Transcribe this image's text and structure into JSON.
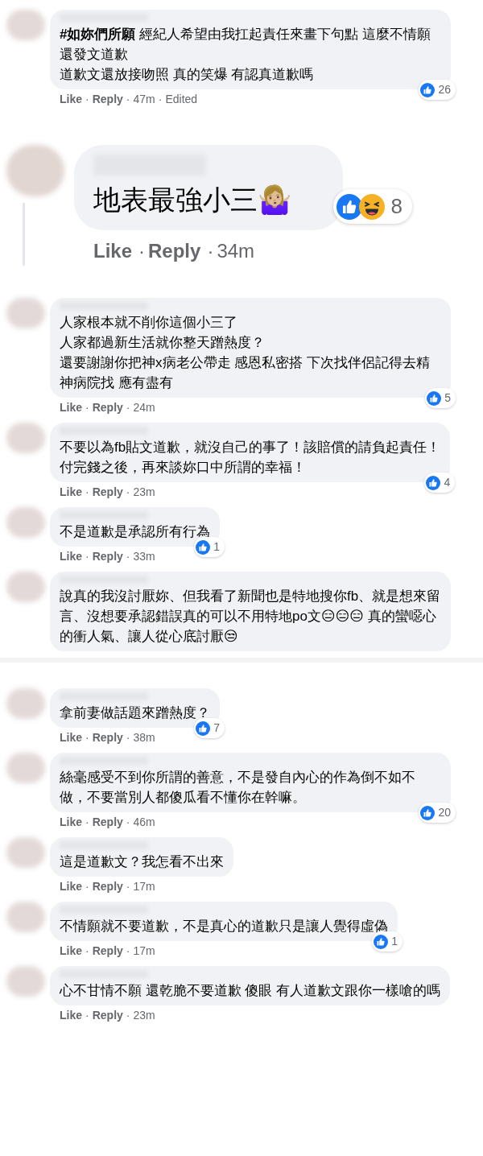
{
  "separator": "·",
  "panels": [
    {
      "comments": [
        {
          "kind": "normal",
          "lines": [
            "**#如妳們所願** 經紀人希望由我扛起責任來畫下句點 這麼不情願還發文道歉",
            "道歉文還放接吻照 真的笑爆 有認真道歉嗎"
          ],
          "meta": [
            "Like",
            "Reply",
            "47m",
            "Edited"
          ],
          "reactions": [
            {
              "kind": "like"
            }
          ],
          "reaction_count": "26"
        }
      ]
    },
    {
      "comments": [
        {
          "kind": "zoomed",
          "lines": [
            "地表最強小三🤷🏼‍♀️"
          ],
          "meta": [
            "Like",
            "Reply",
            "34m"
          ],
          "reactions": [
            {
              "kind": "like"
            },
            {
              "kind": "haha"
            }
          ],
          "reaction_count": "8"
        }
      ]
    },
    {
      "comments": [
        {
          "kind": "normal",
          "lines": [
            "人家根本就不削你這個小三了",
            "人家都過新生活就你整天蹭熱度？",
            "還要謝謝你把神x病老公帶走 感恩私密搭 下次找伴侶記得去精神病院找 應有盡有"
          ],
          "meta": [
            "Like",
            "Reply",
            "24m"
          ],
          "reactions": [
            {
              "kind": "like"
            }
          ],
          "reaction_count": "5"
        },
        {
          "kind": "normal",
          "lines": [
            "不要以為fb貼文道歉，就沒自己的事了！該賠償的請負起責任！",
            "付完錢之後，再來談妳口中所謂的幸福！"
          ],
          "meta": [
            "Like",
            "Reply",
            "23m"
          ],
          "reactions": [
            {
              "kind": "like"
            }
          ],
          "reaction_count": "4"
        },
        {
          "kind": "normal",
          "lines": [
            "不是道歉是承認所有行為"
          ],
          "meta": [
            "Like",
            "Reply",
            "33m"
          ],
          "reactions": [
            {
              "kind": "like"
            }
          ],
          "reaction_count": "1"
        },
        {
          "kind": "normal",
          "lines": [
            "說真的我沒討厭妳、但我看了新聞也是特地搜你fb、就是想來留言、沒想要承認錯誤真的可以不用特地po文😑😑😑 真的蠻噁心的衝人氣、讓人從心底討厭😒"
          ]
        }
      ]
    },
    {
      "comments": [
        {
          "kind": "normal",
          "lines": [
            "拿前妻做話題來蹭熱度？"
          ],
          "meta": [
            "Like",
            "Reply",
            "38m"
          ],
          "reactions": [
            {
              "kind": "like"
            }
          ],
          "reaction_count": "7"
        },
        {
          "kind": "normal",
          "lines": [
            "絲毫感受不到你所謂的善意，不是發自內心的作為倒不如不做，不要當別人都傻瓜看不懂你在幹嘛。"
          ],
          "meta": [
            "Like",
            "Reply",
            "46m"
          ],
          "reactions": [
            {
              "kind": "like"
            }
          ],
          "reaction_count": "20"
        },
        {
          "kind": "normal",
          "lines": [
            "這是道歉文？我怎看不出來"
          ],
          "meta": [
            "Like",
            "Reply",
            "17m"
          ]
        },
        {
          "kind": "normal",
          "lines": [
            "不情願就不要道歉，不是真心的道歉只是讓人覺得虛偽"
          ],
          "meta": [
            "Like",
            "Reply",
            "17m"
          ],
          "reactions": [
            {
              "kind": "like"
            }
          ],
          "reaction_count": "1"
        },
        {
          "kind": "normal",
          "lines": [
            "心不甘情不願 還乾脆不要道歉 傻眼 有人道歉文跟你一樣嗆的嗎"
          ],
          "meta": [
            "Like",
            "Reply",
            "23m"
          ]
        }
      ]
    }
  ]
}
